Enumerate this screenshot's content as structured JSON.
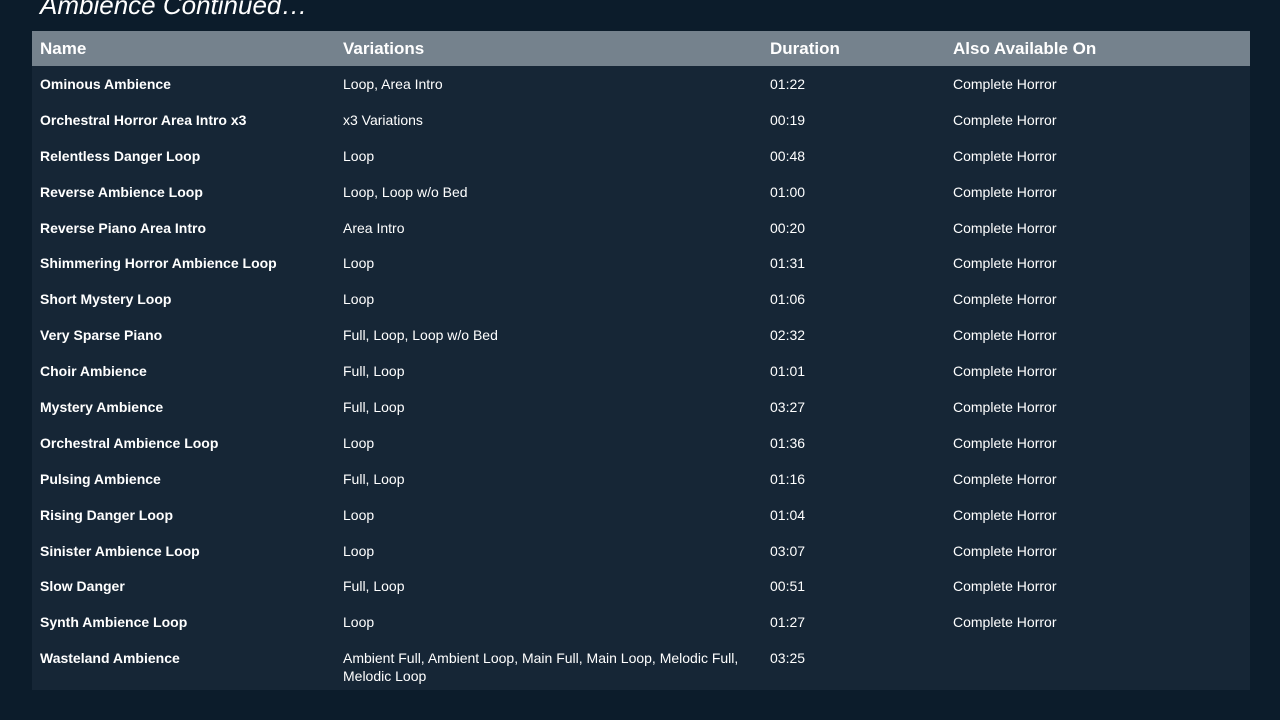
{
  "page": {
    "title": "Ambience Continued…"
  },
  "table": {
    "columns": [
      "Name",
      "Variations",
      "Duration",
      "Also Available On"
    ],
    "rows": [
      {
        "name": "Ominous Ambience",
        "variations": "Loop, Area Intro",
        "duration": "01:22",
        "also": "Complete Horror"
      },
      {
        "name": "Orchestral Horror Area Intro x3",
        "variations": "x3 Variations",
        "duration": "00:19",
        "also": "Complete Horror"
      },
      {
        "name": "Relentless Danger Loop",
        "variations": "Loop",
        "duration": "00:48",
        "also": "Complete Horror"
      },
      {
        "name": "Reverse Ambience Loop",
        "variations": "Loop, Loop w/o Bed",
        "duration": "01:00",
        "also": "Complete Horror"
      },
      {
        "name": "Reverse Piano Area Intro",
        "variations": "Area Intro",
        "duration": "00:20",
        "also": "Complete Horror"
      },
      {
        "name": "Shimmering Horror Ambience Loop",
        "variations": "Loop",
        "duration": "01:31",
        "also": "Complete Horror"
      },
      {
        "name": "Short Mystery Loop",
        "variations": "Loop",
        "duration": "01:06",
        "also": "Complete Horror"
      },
      {
        "name": "Very Sparse Piano",
        "variations": "Full, Loop, Loop w/o Bed",
        "duration": "02:32",
        "also": "Complete Horror"
      },
      {
        "name": "Choir Ambience",
        "variations": "Full, Loop",
        "duration": "01:01",
        "also": "Complete Horror"
      },
      {
        "name": "Mystery Ambience",
        "variations": "Full, Loop",
        "duration": "03:27",
        "also": "Complete Horror"
      },
      {
        "name": "Orchestral Ambience Loop",
        "variations": "Loop",
        "duration": "01:36",
        "also": "Complete Horror"
      },
      {
        "name": "Pulsing Ambience",
        "variations": "Full, Loop",
        "duration": "01:16",
        "also": "Complete Horror"
      },
      {
        "name": "Rising Danger Loop",
        "variations": "Loop",
        "duration": "01:04",
        "also": "Complete Horror"
      },
      {
        "name": "Sinister Ambience Loop",
        "variations": "Loop",
        "duration": "03:07",
        "also": "Complete Horror"
      },
      {
        "name": "Slow Danger",
        "variations": "Full, Loop",
        "duration": "00:51",
        "also": "Complete Horror"
      },
      {
        "name": "Synth Ambience Loop",
        "variations": "Loop",
        "duration": "01:27",
        "also": "Complete Horror"
      },
      {
        "name": "Wasteland Ambience",
        "variations": "Ambient Full, Ambient Loop, Main Full, Main Loop, Melodic Full, Melodic Loop",
        "duration": "03:25",
        "also": ""
      }
    ]
  },
  "colors": {
    "background": "#0c1c2b",
    "table_body": "#162636",
    "header": "#75828d",
    "text": "#ffffff"
  }
}
